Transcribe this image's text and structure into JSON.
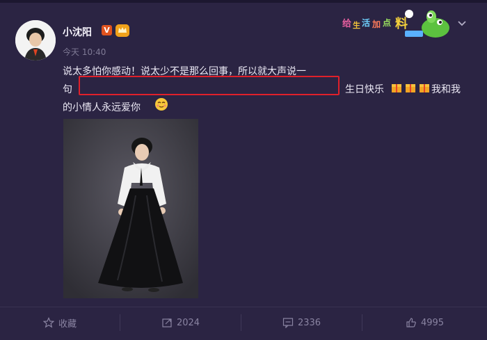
{
  "post": {
    "author": "小沈阳",
    "badge_v": "V",
    "timestamp": "今天 10:40",
    "line1": "说太多怕你感动！说太少不是那么回事，所以就大声说一",
    "line2_prefix": "句",
    "line2_suffix": "生日快乐",
    "line2_tail": "我和我",
    "line3": "的小情人永远爱你",
    "icons": [
      "gift-icon",
      "gift-icon",
      "gift-icon",
      "smile-emoji"
    ]
  },
  "actions": [
    {
      "icon": "star-icon",
      "label": "收藏"
    },
    {
      "icon": "share-icon",
      "label": "2024"
    },
    {
      "icon": "comment-icon",
      "label": "2336"
    },
    {
      "icon": "like-icon",
      "label": "4995"
    }
  ],
  "colors": {
    "background": "#2b2443",
    "highlight": "#e0202a",
    "text": "#ece9f5",
    "muted": "#8a84a2"
  }
}
